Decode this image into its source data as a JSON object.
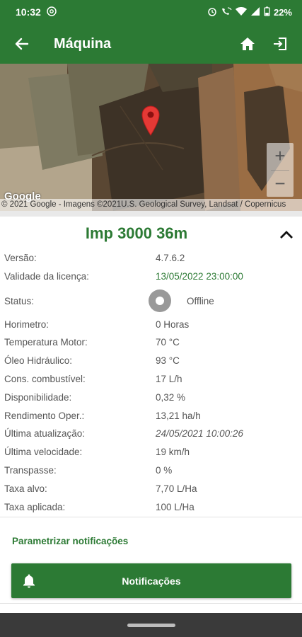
{
  "status_bar": {
    "time": "10:32",
    "battery": "22%"
  },
  "app_bar": {
    "title": "Máquina",
    "back_icon": "arrow-left-icon",
    "home_icon": "home-icon",
    "exit_icon": "exit-icon"
  },
  "map": {
    "google_logo": "Google",
    "attribution": "© 2021 Google - Imagens ©2021U.S. Geological Survey, Landsat / Copernicus",
    "zoom_in": "+",
    "zoom_out": "−"
  },
  "machine": {
    "name": "Imp 3000 36m",
    "fields": [
      {
        "label": "Versão:",
        "value": "4.7.6.2"
      },
      {
        "label": "Validade da licença:",
        "value": "13/05/2022 23:00:00"
      },
      {
        "label": "Status:",
        "value": "Offline"
      },
      {
        "label": "Horimetro:",
        "value": "0 Horas"
      },
      {
        "label": "Temperatura Motor:",
        "value": "70 °C"
      },
      {
        "label": "Óleo Hidráulico:",
        "value": "93 °C"
      },
      {
        "label": "Cons. combustível:",
        "value": "17 L/h"
      },
      {
        "label": "Disponibilidade:",
        "value": "0,32 %"
      },
      {
        "label": "Rendimento Oper.:",
        "value": "13,21 ha/h"
      },
      {
        "label": "Última atualização:",
        "value": "24/05/2021 10:00:26"
      },
      {
        "label": "Última velocidade:",
        "value": "19 km/h"
      },
      {
        "label": "Transpasse:",
        "value": "0 %"
      },
      {
        "label": "Taxa alvo:",
        "value": "7,70 L/Ha"
      },
      {
        "label": "Taxa aplicada:",
        "value": "100 L/Ha"
      }
    ]
  },
  "actions": {
    "parametrize_label": "Parametrizar notificações",
    "notifications_label": "Notificações"
  },
  "colors": {
    "primary": "#2c7a34",
    "status_offline": "#999999"
  }
}
